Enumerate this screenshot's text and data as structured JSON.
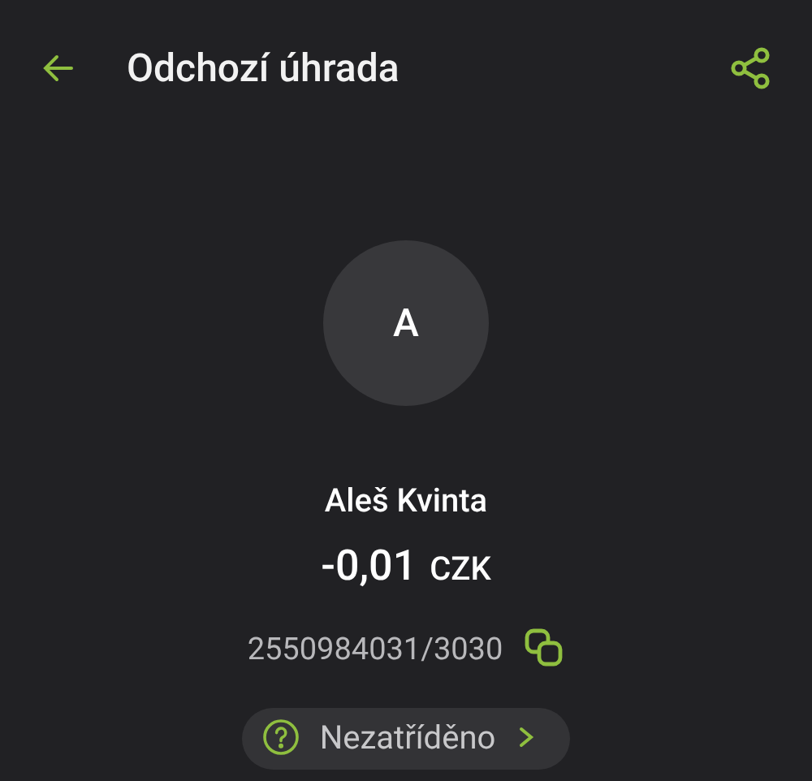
{
  "header": {
    "title": "Odchozí úhrada"
  },
  "counterparty": {
    "initial": "A",
    "name": "Aleš Kvinta",
    "amount": "-0,01",
    "currency": "CZK",
    "account": "2550984031/3030"
  },
  "category": {
    "label": "Nezatříděno"
  }
}
